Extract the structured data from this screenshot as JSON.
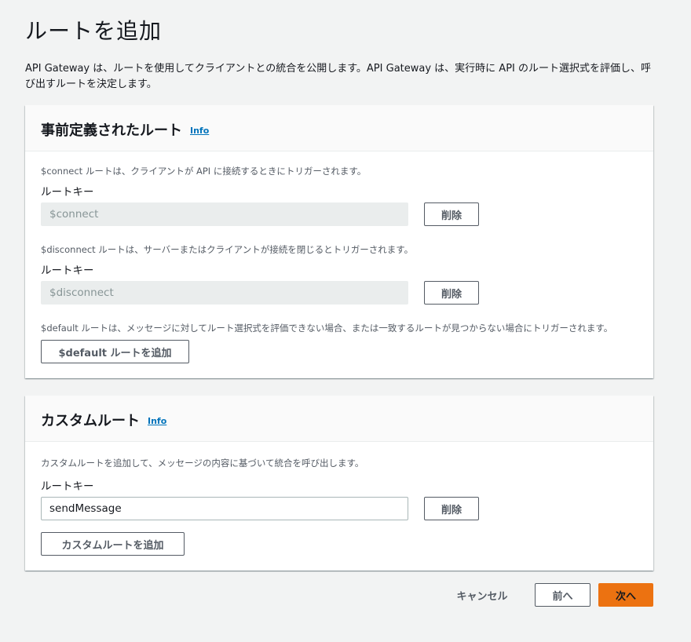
{
  "page": {
    "title": "ルートを追加",
    "description": "API Gateway は、ルートを使用してクライアントとの統合を公開します。API Gateway は、実行時に API のルート選択式を評価し、呼び出すルートを決定します。"
  },
  "predefined": {
    "title": "事前定義されたルート",
    "info_label": "Info",
    "connect": {
      "helper": "$connect ルートは、クライアントが API に接続するときにトリガーされます。",
      "label": "ルートキー",
      "value": "$connect",
      "remove_label": "削除"
    },
    "disconnect": {
      "helper": "$disconnect ルートは、サーバーまたはクライアントが接続を閉じるとトリガーされます。",
      "label": "ルートキー",
      "value": "$disconnect",
      "remove_label": "削除"
    },
    "default": {
      "helper": "$default ルートは、メッセージに対してルート選択式を評価できない場合、または一致するルートが見つからない場合にトリガーされます。",
      "add_label": "$default ルートを追加"
    }
  },
  "custom": {
    "title": "カスタムルート",
    "info_label": "Info",
    "helper": "カスタムルートを追加して、メッセージの内容に基づいて統合を呼び出します。",
    "label": "ルートキー",
    "value": "sendMessage",
    "remove_label": "削除",
    "add_label": "カスタムルートを追加"
  },
  "footer": {
    "cancel_label": "キャンセル",
    "previous_label": "前へ",
    "next_label": "次へ"
  },
  "colors": {
    "background": "#f2f3f3",
    "primary": "#ec7211",
    "link": "#0073bb"
  }
}
